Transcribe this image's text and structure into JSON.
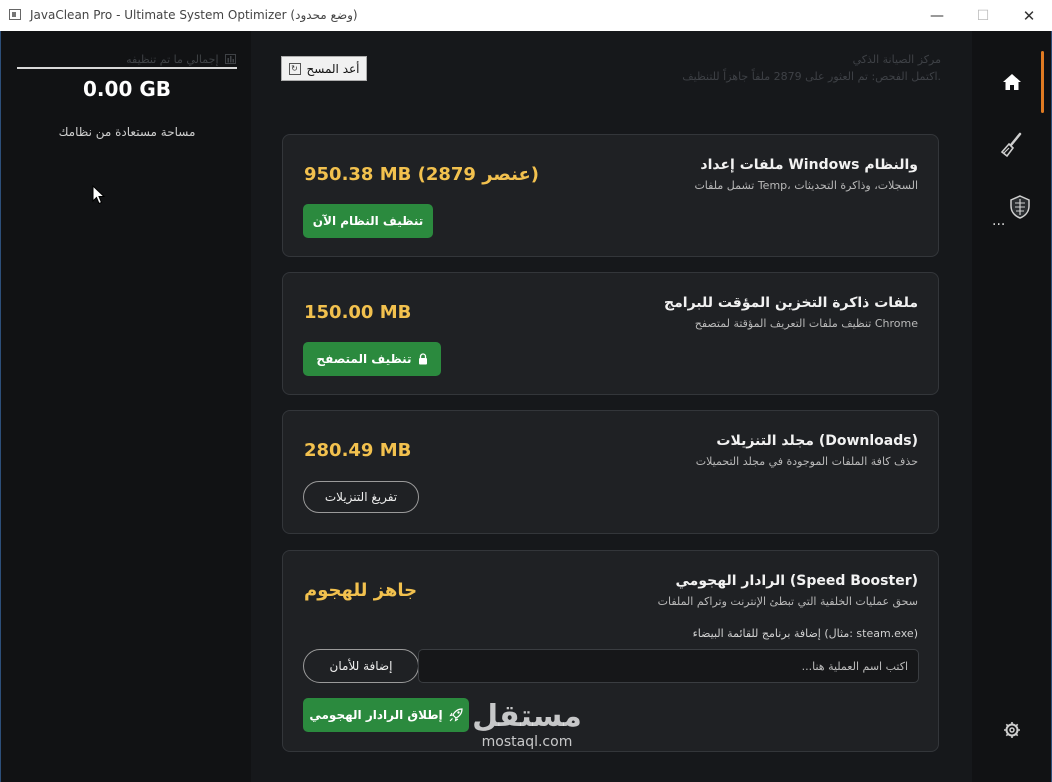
{
  "window": {
    "title": "JavaClean Pro - Ultimate System Optimizer (وضع محدود)",
    "minimize": "—",
    "maximize": "☐",
    "close": "✕"
  },
  "summary": {
    "label": "إجمالي ما تم تنظيفه",
    "value": "0.00 GB",
    "subtitle": "مساحة مستعادة من نظامك"
  },
  "header": {
    "rescan_label": "أعد المسح",
    "title": "مركز الصيانة الذكي",
    "subtitle": "اكتمل الفحص: تم العثور على 2879 ملفاً جاهزاً للتنظيف."
  },
  "cards": [
    {
      "title": "ملفات إعداد Windows والنظام",
      "desc": "تشمل ملفات Temp، السجلات، وذاكرة التحديثات",
      "size": "950.38 MB (2879 عنصر)",
      "button": "تنظيف النظام الآن"
    },
    {
      "title": "ملفات ذاكرة التخزين المؤقت للبرامج",
      "desc": "تنظيف ملفات التعريف المؤقتة لمتصفح Chrome",
      "size": "150.00 MB",
      "button": "تنظيف المتصفح"
    },
    {
      "title": "مجلد التنزيلات (Downloads)",
      "desc": "حذف كافة الملفات الموجودة في مجلد التحميلات",
      "size": "280.49 MB",
      "button": "تفريغ التنزيلات"
    },
    {
      "title": "الرادار الهجومي (Speed Booster)",
      "desc": "سحق عمليات الخلفية التي تبطئ الإنترنت وتراكم الملفات",
      "status": "جاهز للهجوم",
      "whitelist_label": "إضافة برنامج للقائمة البيضاء (مثال: steam.exe)",
      "input_placeholder": "اكتب اسم العملية هنا...",
      "add_button": "إضافة للأمان",
      "launch_button": "إطلاق الرادار الهجومي"
    }
  ],
  "nav": {
    "items": [
      "home-icon",
      "brush-icon",
      "shield-icon",
      "settings-icon"
    ],
    "more": "...",
    "accent": "#e07b22"
  },
  "watermark": {
    "arabic": "مستقل",
    "latin": "mostaql.com"
  },
  "colors": {
    "green": "#2b8a3e",
    "gold": "#f2c14e",
    "card": "#1f2124",
    "background": "#16181b"
  }
}
